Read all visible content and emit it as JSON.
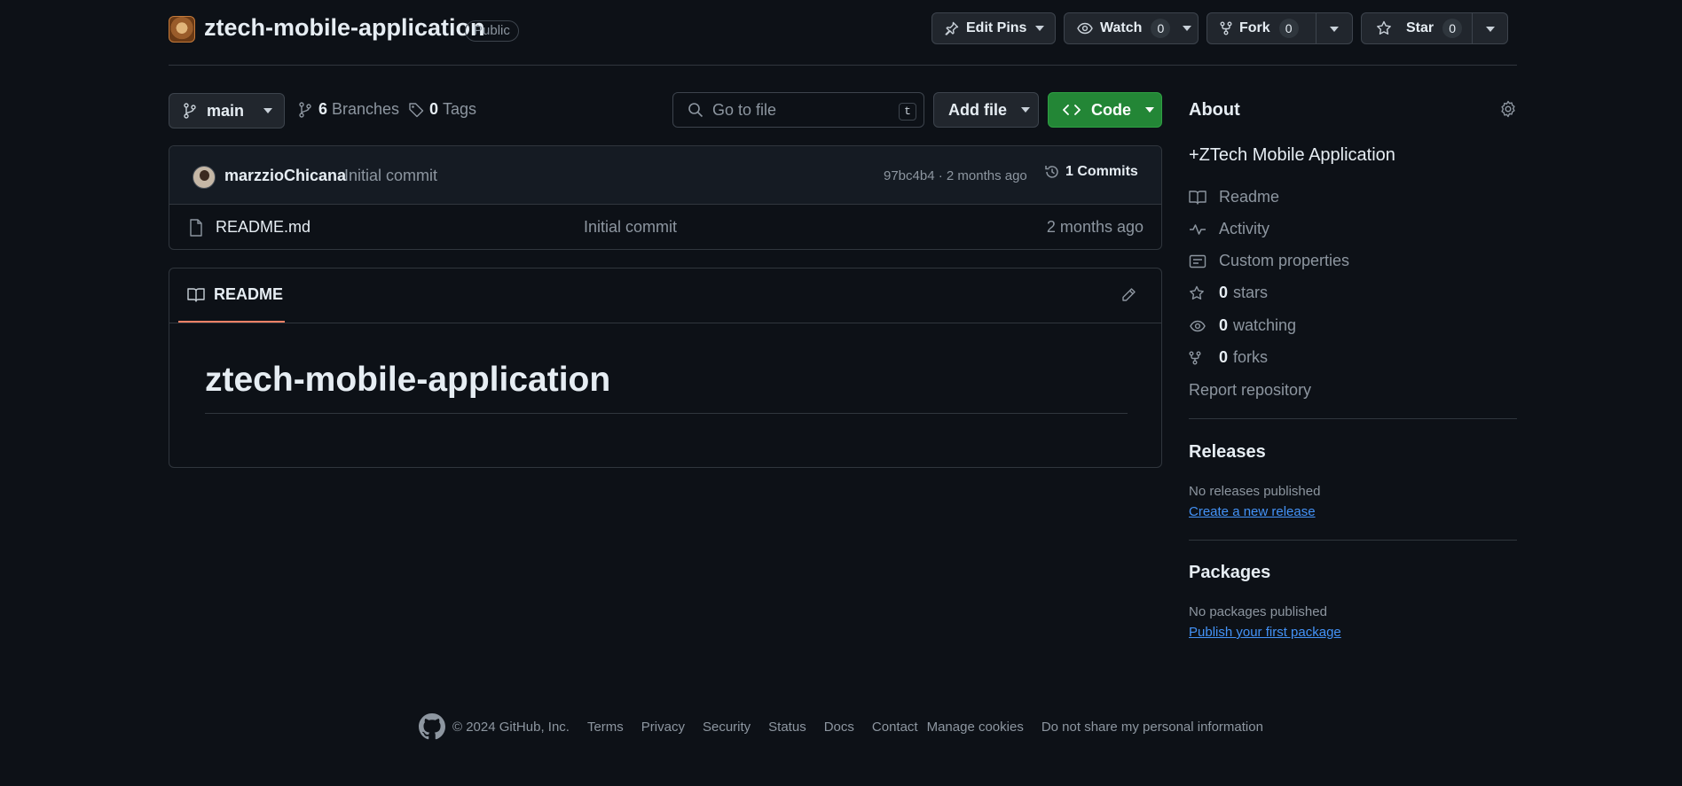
{
  "repo": {
    "name": "ztech-mobile-application",
    "visibility": "Public"
  },
  "header_actions": {
    "edit_pins": "Edit Pins",
    "watch": "Watch",
    "watch_count": "0",
    "fork": "Fork",
    "fork_count": "0",
    "star": "Star",
    "star_count": "0"
  },
  "toolbar": {
    "branch": "main",
    "branches_count": "6",
    "branches_label": "Branches",
    "tags_count": "0",
    "tags_label": "Tags",
    "goto_placeholder": "Go to file",
    "goto_shortcut": "t",
    "add_file": "Add file",
    "code": "Code"
  },
  "latest_commit": {
    "author": "marzzioChicana",
    "message": "Initial commit",
    "meta": "97bc4b4 · 2 months ago",
    "commits_label": "1 Commits"
  },
  "files": [
    {
      "name": "README.md",
      "commit": "Initial commit",
      "time": "2 months ago"
    }
  ],
  "readme": {
    "tab": "README",
    "heading": "ztech-mobile-application"
  },
  "about": {
    "title": "About",
    "description": "+ZTech Mobile Application",
    "readme": "Readme",
    "activity": "Activity",
    "custom_properties": "Custom properties",
    "stars_count": "0",
    "stars_label": "stars",
    "watching_count": "0",
    "watching_label": "watching",
    "forks_count": "0",
    "forks_label": "forks",
    "report": "Report repository"
  },
  "releases": {
    "title": "Releases",
    "note": "No releases published",
    "link": "Create a new release"
  },
  "packages": {
    "title": "Packages",
    "note": "No packages published",
    "link": "Publish your first package"
  },
  "footer": {
    "copyright": "© 2024 GitHub, Inc.",
    "links": [
      "Terms",
      "Privacy",
      "Security",
      "Status",
      "Docs",
      "Contact",
      "Manage cookies",
      "Do not share my personal information"
    ]
  },
  "colors": {
    "background": "#0d1117",
    "border": "#30363d",
    "code_button": "#238636",
    "link": "#4493f8",
    "tab_underline": "#f78166"
  }
}
